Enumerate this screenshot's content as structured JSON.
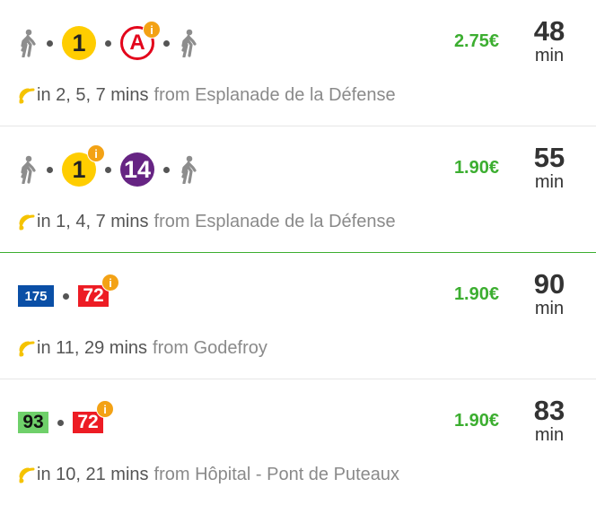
{
  "routes": [
    {
      "price": "2.75€",
      "duration": "48",
      "duration_unit": "min",
      "next_times": "in 2, 5, 7 mins",
      "stop": "from Esplanade de la Défense",
      "legs": [
        {
          "kind": "walk",
          "icon": "walking-person-icon"
        },
        {
          "kind": "metro",
          "label": "1",
          "color": "#ffcd00",
          "text_color": "#222222"
        },
        {
          "kind": "rer",
          "label": "A",
          "color": "#e3051b",
          "info": "i"
        },
        {
          "kind": "walk",
          "icon": "walking-person-icon"
        }
      ]
    },
    {
      "price": "1.90€",
      "duration": "55",
      "duration_unit": "min",
      "next_times": "in 1, 4, 7 mins",
      "stop": "from Esplanade de la Défense",
      "legs": [
        {
          "kind": "walk",
          "icon": "walking-person-icon"
        },
        {
          "kind": "metro",
          "label": "1",
          "color": "#ffcd00",
          "text_color": "#222222",
          "info": "i"
        },
        {
          "kind": "metro",
          "label": "14",
          "color": "#662483",
          "text_color": "#ffffff"
        },
        {
          "kind": "walk",
          "icon": "walking-person-icon"
        }
      ]
    },
    {
      "price": "1.90€",
      "duration": "90",
      "duration_unit": "min",
      "next_times": "in 11, 29 mins",
      "stop": "from Godefroy",
      "legs": [
        {
          "kind": "bus",
          "label": "175",
          "color": "#0a4fa6",
          "text_color": "#ffffff"
        },
        {
          "kind": "bus",
          "label": "72",
          "color": "#ed1c24",
          "text_color": "#ffffff",
          "info": "i"
        }
      ]
    },
    {
      "price": "1.90€",
      "duration": "83",
      "duration_unit": "min",
      "next_times": "in 10, 21 mins",
      "stop": "from Hôpital - Pont de Puteaux",
      "legs": [
        {
          "kind": "bus",
          "label": "93",
          "color": "#6fd06a",
          "text_color": "#111111"
        },
        {
          "kind": "bus",
          "label": "72",
          "color": "#ed1c24",
          "text_color": "#ffffff",
          "info": "i"
        }
      ]
    }
  ],
  "colors": {
    "price_green": "#3cae30",
    "realtime_icon": "#f5c300",
    "info_badge": "#f3a215",
    "divider": "#e6e6e6",
    "divider_green": "#3cae30"
  }
}
